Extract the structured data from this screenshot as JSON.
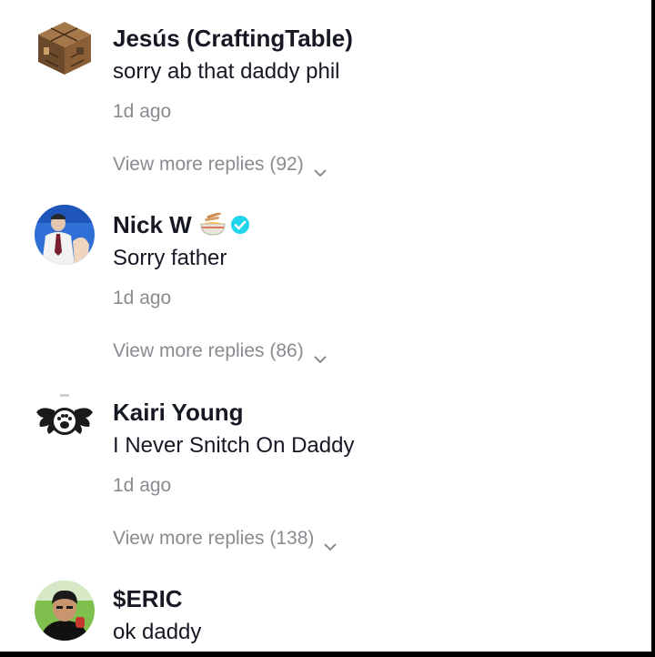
{
  "comments": [
    {
      "username": "Jesús (CraftingTable)",
      "text": "sorry ab that daddy phil",
      "time": "1d ago",
      "replies_label": "View more replies (92)",
      "avatar_icon": "crafting-table-avatar",
      "verified": false
    },
    {
      "username": "Nick W",
      "text": "Sorry father",
      "time": "1d ago",
      "replies_label": "View more replies (86)",
      "avatar_icon": "person-photo-avatar",
      "verified": true,
      "badges": [
        "noodle-bowl-emoji",
        "verified-check-icon"
      ]
    },
    {
      "username": "Kairi Young",
      "text": "I Never Snitch On Daddy",
      "time": "1d ago",
      "replies_label": "View more replies (138)",
      "avatar_icon": "winged-paw-logo-avatar",
      "verified": false
    },
    {
      "username": "$ERIC",
      "text": "ok daddy",
      "avatar_icon": "person-photo-avatar",
      "verified": false
    }
  ],
  "colors": {
    "text": "#161823",
    "secondary": "#8a8b91",
    "verified": "#20d5ec",
    "frame": "#000000"
  }
}
